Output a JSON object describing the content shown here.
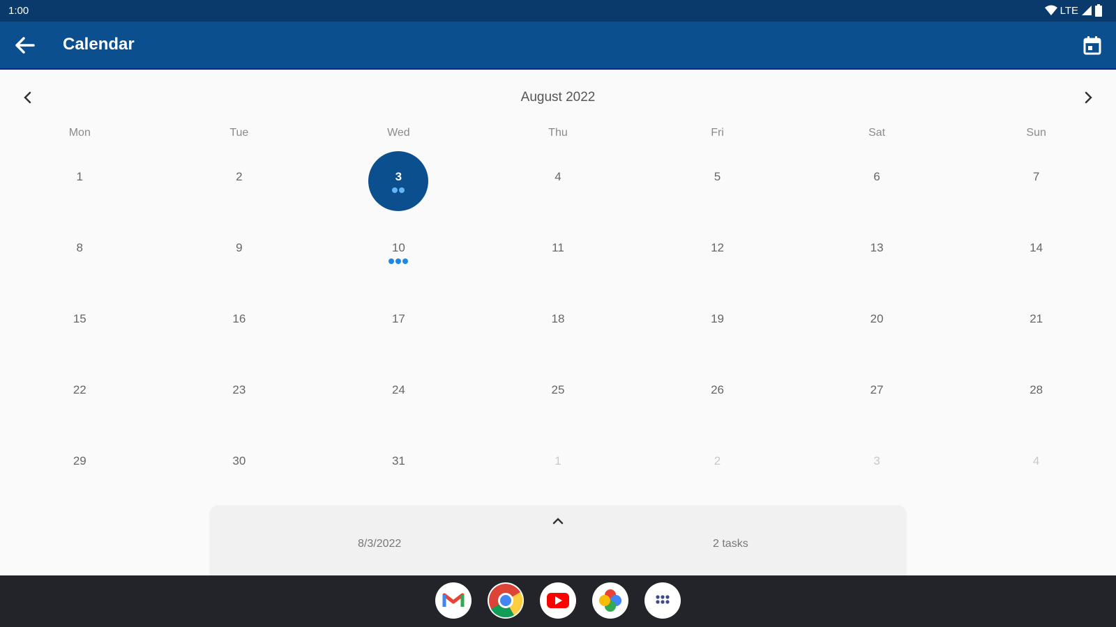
{
  "status_bar": {
    "time": "1:00",
    "network": "LTE"
  },
  "app_bar": {
    "title": "Calendar"
  },
  "calendar": {
    "month_label": "August 2022",
    "weekdays": [
      "Mon",
      "Tue",
      "Wed",
      "Thu",
      "Fri",
      "Sat",
      "Sun"
    ],
    "weeks": [
      [
        "1",
        "2",
        "3",
        "4",
        "5",
        "6",
        "7"
      ],
      [
        "8",
        "9",
        "10",
        "11",
        "12",
        "13",
        "14"
      ],
      [
        "15",
        "16",
        "17",
        "18",
        "19",
        "20",
        "21"
      ],
      [
        "22",
        "23",
        "24",
        "25",
        "26",
        "27",
        "28"
      ],
      [
        "29",
        "30",
        "31",
        "1",
        "2",
        "3",
        "4"
      ]
    ]
  },
  "bottom_sheet": {
    "date": "8/3/2022",
    "task_count": "2 tasks"
  },
  "dock_apps": [
    "Gmail",
    "Chrome",
    "YouTube",
    "Photos",
    "App drawer"
  ],
  "colors": {
    "primary": "#0b4f8f",
    "status": "#0a3a6b",
    "dot": "#1e88e5"
  }
}
